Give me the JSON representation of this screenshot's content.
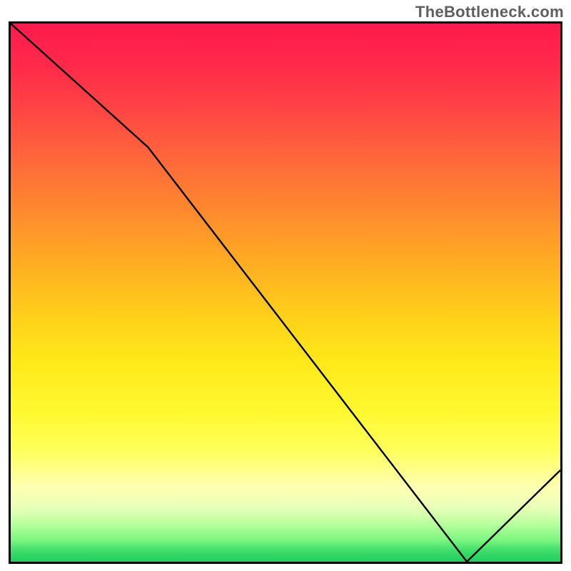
{
  "attribution": "TheBottleneck.com",
  "x_annotation_label": "",
  "chart_data": {
    "type": "line",
    "title": "",
    "xlabel": "",
    "ylabel": "",
    "xlim": [
      0,
      1
    ],
    "ylim": [
      0,
      1
    ],
    "grid": false,
    "legend": false,
    "series": [
      {
        "name": "curve",
        "x": [
          0.0,
          0.25,
          0.83,
          1.0
        ],
        "y": [
          1.0,
          0.77,
          0.0,
          0.17
        ]
      }
    ],
    "background_gradient": {
      "direction": "vertical",
      "stops": [
        {
          "pos": 0.0,
          "color": "#ff1a4d"
        },
        {
          "pos": 0.45,
          "color": "#ffae22"
        },
        {
          "pos": 0.72,
          "color": "#fff82f"
        },
        {
          "pos": 0.9,
          "color": "#e8ffb8"
        },
        {
          "pos": 1.0,
          "color": "#1ecf5f"
        }
      ]
    },
    "annotations": [
      {
        "text": "",
        "x": 0.82,
        "y": 0.0,
        "color": "#d6332e"
      }
    ]
  }
}
